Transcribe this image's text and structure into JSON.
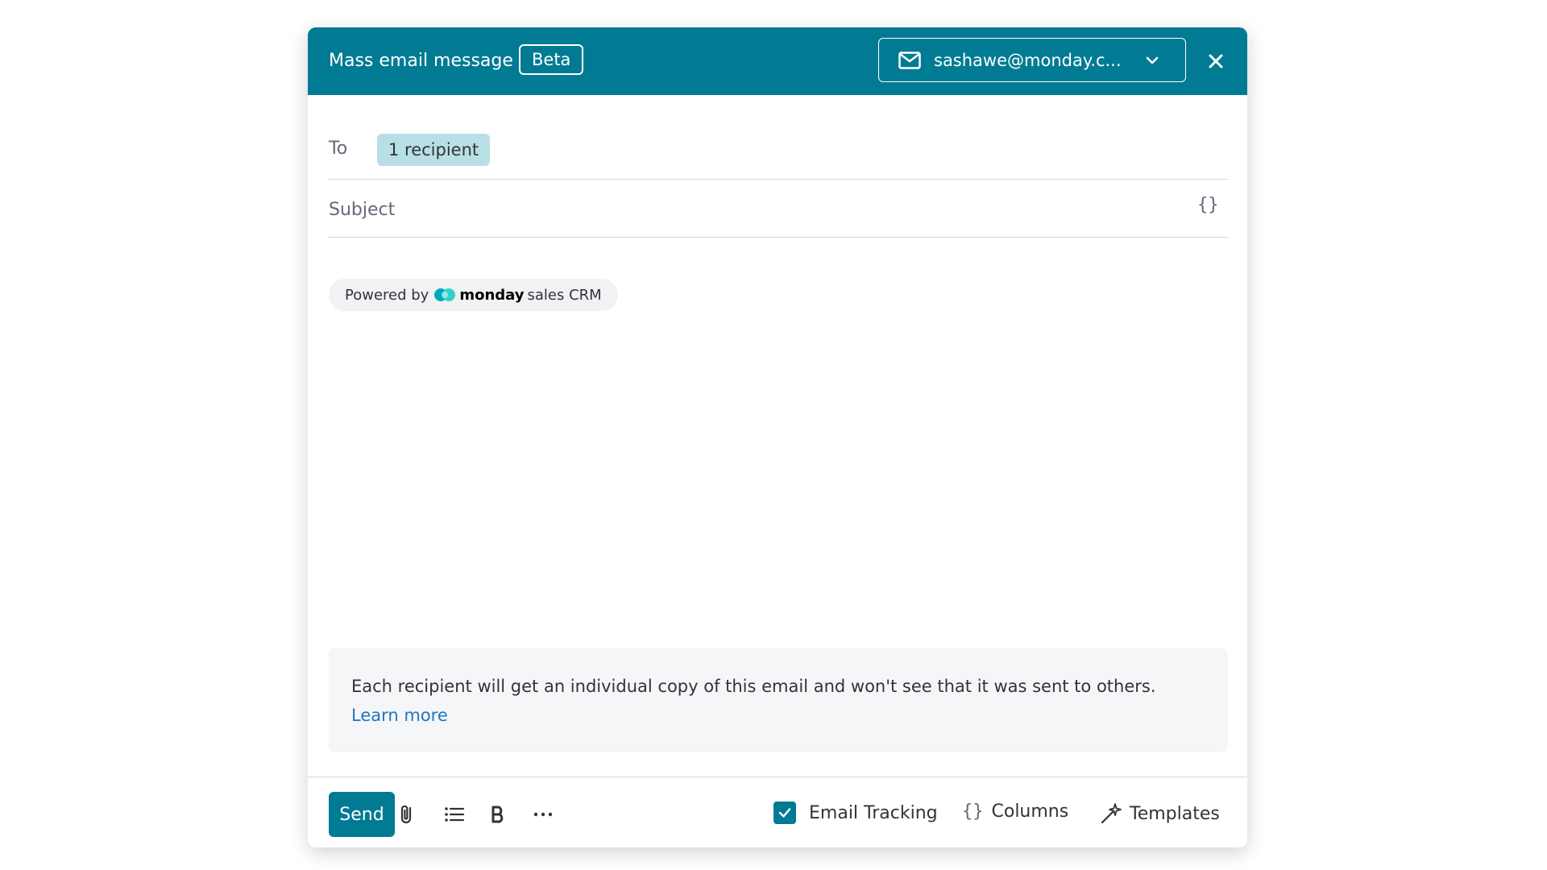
{
  "header": {
    "title": "Mass email message",
    "badge": "Beta",
    "account": "sashawe@monday.c...",
    "icons": [
      "mail-icon",
      "chevron-down-icon",
      "close-icon"
    ]
  },
  "to": {
    "label": "To",
    "recipients": "1 recipient"
  },
  "subject": {
    "placeholder": "Subject",
    "variables_button": "{}"
  },
  "body": {
    "powered_prefix": "Powered by",
    "brand_name": "monday",
    "brand_suffix": "sales CRM"
  },
  "info": {
    "message": "Each recipient will get an individual copy of this email and won't see that it was sent to others.",
    "link": "Learn more"
  },
  "footer": {
    "send": "Send",
    "email_tracking": "Email Tracking",
    "email_tracking_checked": true,
    "columns_icon_text": "{}",
    "columns": "Columns",
    "templates": "Templates",
    "toolbar_icons": [
      "attach-icon",
      "bullet-list-icon",
      "bold-icon",
      "more-icon"
    ]
  },
  "colors": {
    "accent": "#017b93",
    "chip": "#b8dfe4",
    "link": "#1f76c2",
    "info_bg": "#f5f6f8"
  }
}
